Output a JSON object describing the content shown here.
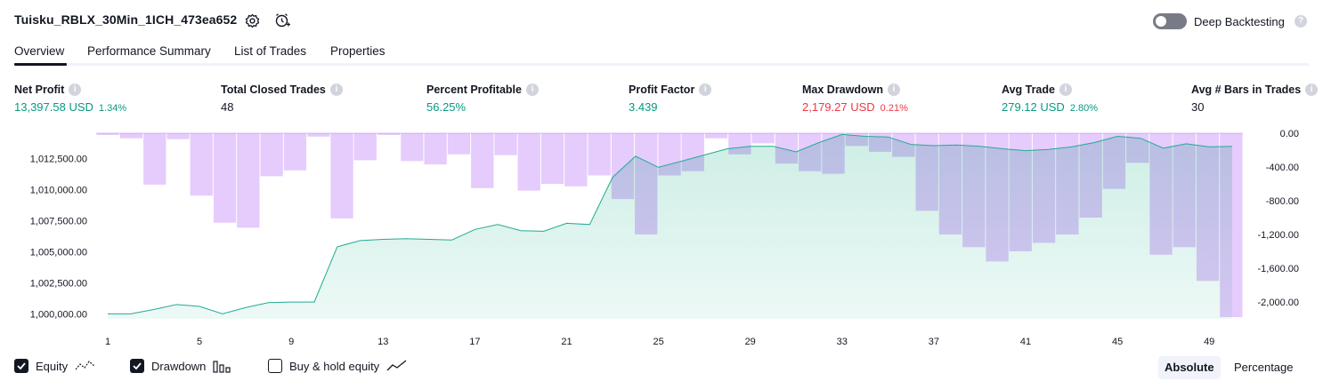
{
  "header": {
    "title": "Tuisku_RBLX_30Min_1ICH_473ea652",
    "deep_backtesting_label": "Deep Backtesting"
  },
  "tabs": [
    {
      "label": "Overview",
      "active": true
    },
    {
      "label": "Performance Summary",
      "active": false
    },
    {
      "label": "List of Trades",
      "active": false
    },
    {
      "label": "Properties",
      "active": false
    }
  ],
  "metrics": [
    {
      "label": "Net Profit",
      "value": "13,397.58 USD",
      "pct": "1.34%",
      "tone": "pos"
    },
    {
      "label": "Total Closed Trades",
      "value": "48",
      "pct": "",
      "tone": "neu"
    },
    {
      "label": "Percent Profitable",
      "value": "56.25%",
      "pct": "",
      "tone": "pos"
    },
    {
      "label": "Profit Factor",
      "value": "3.439",
      "pct": "",
      "tone": "pos"
    },
    {
      "label": "Max Drawdown",
      "value": "2,179.27 USD",
      "pct": "0.21%",
      "tone": "neg"
    },
    {
      "label": "Avg Trade",
      "value": "279.12 USD",
      "pct": "2.80%",
      "tone": "pos"
    },
    {
      "label": "Avg # Bars in Trades",
      "value": "30",
      "pct": "",
      "tone": "neu"
    }
  ],
  "legend": {
    "equity": "Equity",
    "drawdown": "Drawdown",
    "buy_hold": "Buy & hold equity"
  },
  "view_toggle": {
    "absolute": "Absolute",
    "percentage": "Percentage"
  },
  "colors": {
    "equity_line": "#22ab94",
    "equity_fill": "#cdeee5",
    "drawdown_bar": "#e1c3fb",
    "overlap_bar": "#b3b8e6",
    "positive": "#089981",
    "negative": "#f23645"
  },
  "chart_data": {
    "type": "area",
    "x_ticks": [
      "1",
      "5",
      "9",
      "13",
      "17",
      "21",
      "25",
      "29",
      "33",
      "37",
      "41",
      "45",
      "49"
    ],
    "left_ticks": [
      "1,012,500.00",
      "1,010,000.00",
      "1,007,500.00",
      "1,005,000.00",
      "1,002,500.00",
      "1,000,000.00"
    ],
    "right_ticks": [
      "0.00",
      "-400.00",
      "-800.00",
      "-1,200.00",
      "-1,600.00",
      "-2,000.00"
    ],
    "equity_ylim": [
      999600,
      1014550
    ],
    "drawdown_ylim": [
      -2200,
      0
    ],
    "equity": [
      1000000,
      1000000,
      1000350,
      1000750,
      1000600,
      1000000,
      1000500,
      1000900,
      1000950,
      1000950,
      1005400,
      1005900,
      1006000,
      1006050,
      1006000,
      1005950,
      1006800,
      1007200,
      1006700,
      1006650,
      1007300,
      1007200,
      1011000,
      1012700,
      1011800,
      1012300,
      1012800,
      1013300,
      1013500,
      1013500,
      1013050,
      1013800,
      1014450,
      1014300,
      1014250,
      1013650,
      1013550,
      1013600,
      1013500,
      1013300,
      1013150,
      1013250,
      1013450,
      1013800,
      1014300,
      1014150,
      1013350,
      1013700,
      1013450,
      1013500
    ],
    "drawdown": [
      -20,
      -60,
      -610,
      -70,
      -740,
      -1060,
      -1120,
      -510,
      -440,
      -40,
      -1010,
      -320,
      -20,
      -330,
      -370,
      -250,
      -650,
      -260,
      -680,
      -600,
      -630,
      -500,
      -780,
      -1200,
      -500,
      -450,
      -60,
      -250,
      -120,
      -360,
      -450,
      -480,
      -150,
      -220,
      -280,
      -920,
      -1200,
      -1350,
      -1520,
      -1400,
      -1300,
      -1200,
      -1000,
      -660,
      -350,
      -1440,
      -1350,
      -1750,
      -2180
    ]
  }
}
